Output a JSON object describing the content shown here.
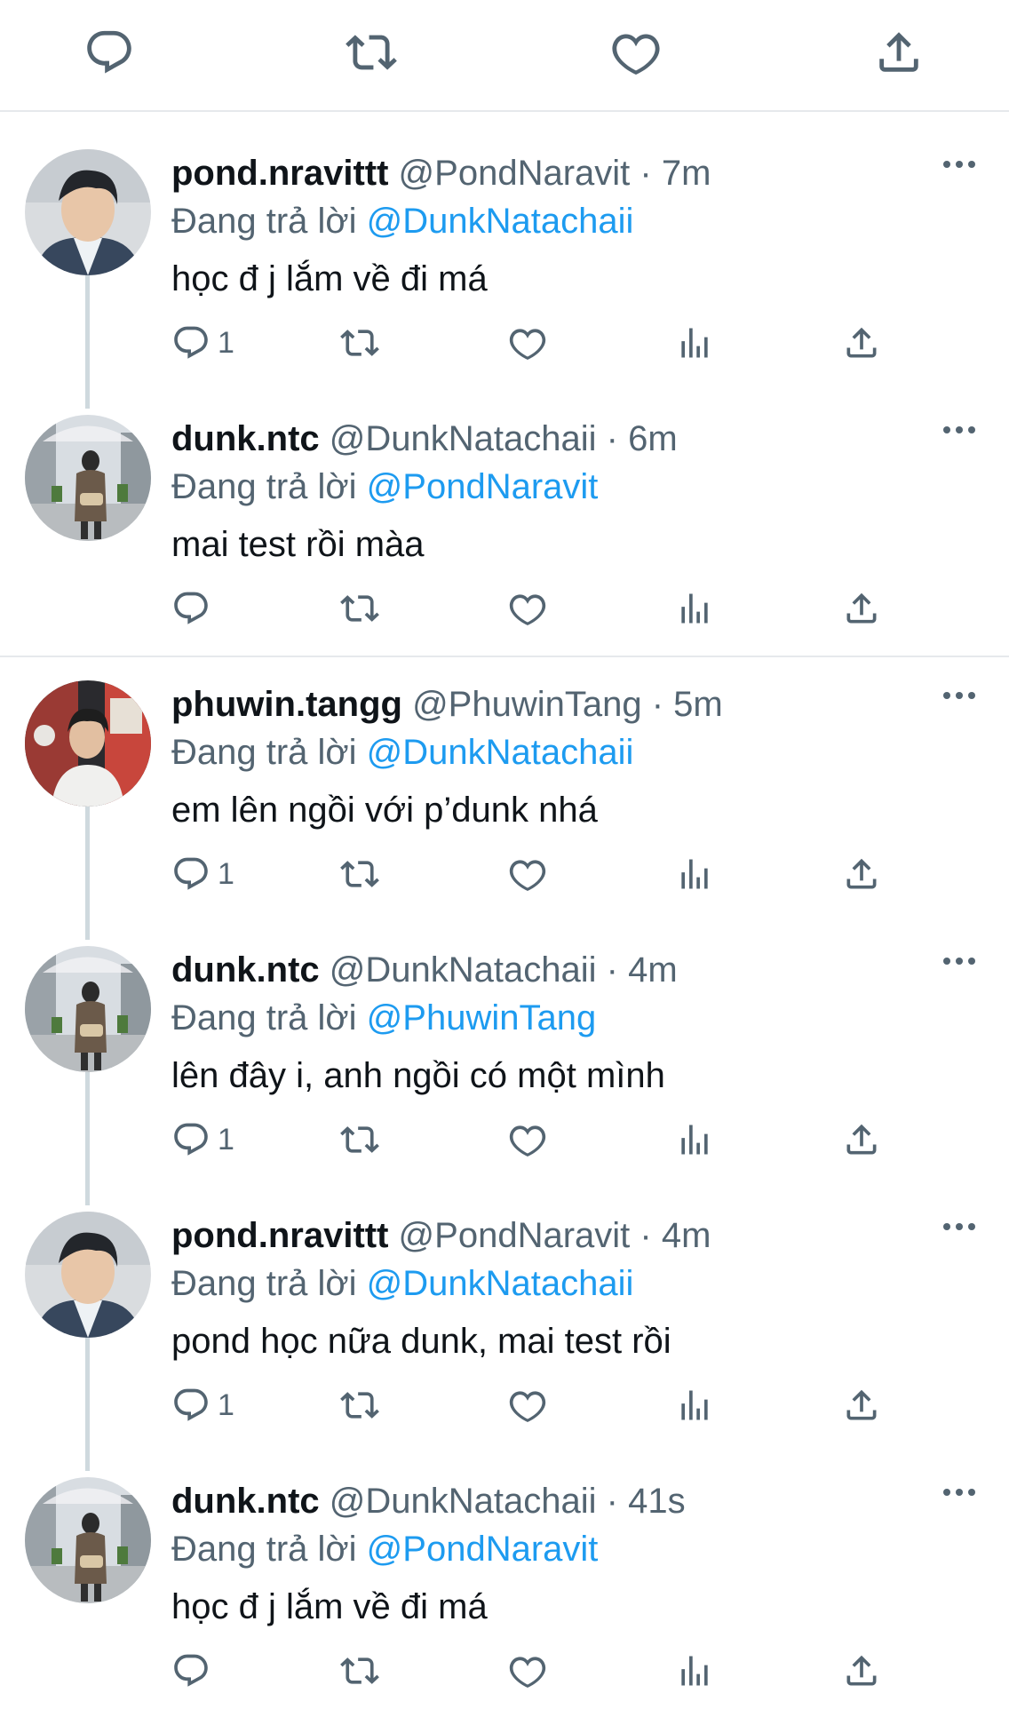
{
  "top_actions": {
    "reply": "reply-icon",
    "retweet": "retweet-icon",
    "like": "heart-icon",
    "share": "share-icon"
  },
  "colors": {
    "accent": "#1d9bf0",
    "text_primary": "#0f1419",
    "text_secondary": "#536471",
    "divider": "#e6e9ec"
  },
  "tweets": [
    {
      "name": "pond.nravittt",
      "handle": "@PondNaravit",
      "time": "· 7m",
      "replying_prefix": "Đang trả lời",
      "replying_to": "@DunkNatachaii",
      "text": "học đ j lắm về đi má",
      "reply_count": "1"
    },
    {
      "name": "dunk.ntc",
      "handle": "@DunkNatachaii",
      "time": "· 6m",
      "replying_prefix": "Đang trả lời",
      "replying_to": "@PondNaravit",
      "text": "mai test rồi màa",
      "reply_count": ""
    },
    {
      "name": "phuwin.tangg",
      "handle": "@PhuwinTang",
      "time": "· 5m",
      "replying_prefix": "Đang trả lời",
      "replying_to": "@DunkNatachaii",
      "text": "em lên ngồi với p’dunk nhá",
      "reply_count": "1"
    },
    {
      "name": "dunk.ntc",
      "handle": "@DunkNatachaii",
      "time": "· 4m",
      "replying_prefix": "Đang trả lời",
      "replying_to": "@PhuwinTang",
      "text": "lên đây i, anh ngồi có một mình",
      "reply_count": "1"
    },
    {
      "name": "pond.nravittt",
      "handle": "@PondNaravit",
      "time": "· 4m",
      "replying_prefix": "Đang trả lời",
      "replying_to": "@DunkNatachaii",
      "text": "pond học nữa dunk, mai test rồi",
      "reply_count": "1"
    },
    {
      "name": "dunk.ntc",
      "handle": "@DunkNatachaii",
      "time": "· 41s",
      "replying_prefix": "Đang trả lời",
      "replying_to": "@PondNaravit",
      "text": "học đ j lắm về đi má",
      "reply_count": ""
    }
  ]
}
